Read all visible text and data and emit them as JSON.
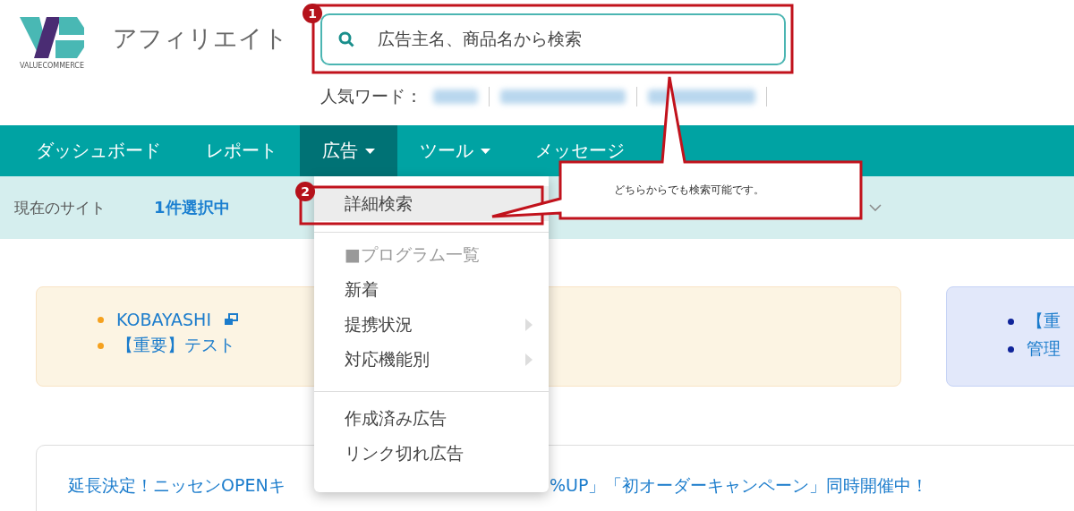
{
  "logo": {
    "brand": "VALUECOMMERCE",
    "title": "アフィリエイト"
  },
  "search": {
    "placeholder": "広告主名、商品名から検索"
  },
  "popular_words": {
    "label": "人気ワード：",
    "items": [
      {
        "kind": "blurred"
      },
      {
        "kind": "blurred"
      },
      {
        "kind": "blurred"
      }
    ]
  },
  "nav": [
    {
      "label": "ダッシュボード",
      "selected": false,
      "has_menu": false
    },
    {
      "label": "レポート",
      "selected": false,
      "has_menu": false
    },
    {
      "label": "広告",
      "selected": true,
      "has_menu": true
    },
    {
      "label": "ツール",
      "selected": false,
      "has_menu": true
    },
    {
      "label": "メッセージ",
      "selected": false,
      "has_menu": false
    }
  ],
  "site_bar": {
    "label": "現在のサイト",
    "value": "1件選択中"
  },
  "dropdown": [
    {
      "kind": "item",
      "label": "詳細検索",
      "highlighted": true
    },
    {
      "kind": "divider"
    },
    {
      "kind": "heading",
      "label": "■プログラム一覧"
    },
    {
      "kind": "item",
      "label": "新着",
      "highlighted": false
    },
    {
      "kind": "submenu",
      "label": "提携状況",
      "highlighted": false
    },
    {
      "kind": "submenu",
      "label": "対応機能別",
      "highlighted": false
    },
    {
      "kind": "divider"
    },
    {
      "kind": "item",
      "label": "作成済み広告",
      "highlighted": false
    },
    {
      "kind": "item",
      "label": "リンク切れ広告",
      "highlighted": false
    }
  ],
  "notices": [
    {
      "kind": "warning",
      "items": [
        {
          "text": "KOBAYASHI",
          "external": true
        },
        {
          "text": "【重要】テスト",
          "external": false
        }
      ]
    },
    {
      "kind": "info",
      "items": [
        {
          "text": "【重"
        },
        {
          "text": "管理"
        }
      ]
    }
  ],
  "banner": {
    "text_left": "延長決定！ニッセンOPENキ",
    "text_right": "%UP」「初オーダーキャンペーン」同時開催中！"
  },
  "annotations": {
    "frames": [
      {
        "number": "1"
      },
      {
        "number": "2"
      }
    ],
    "callout": "どちらからでも検索可能です。"
  }
}
